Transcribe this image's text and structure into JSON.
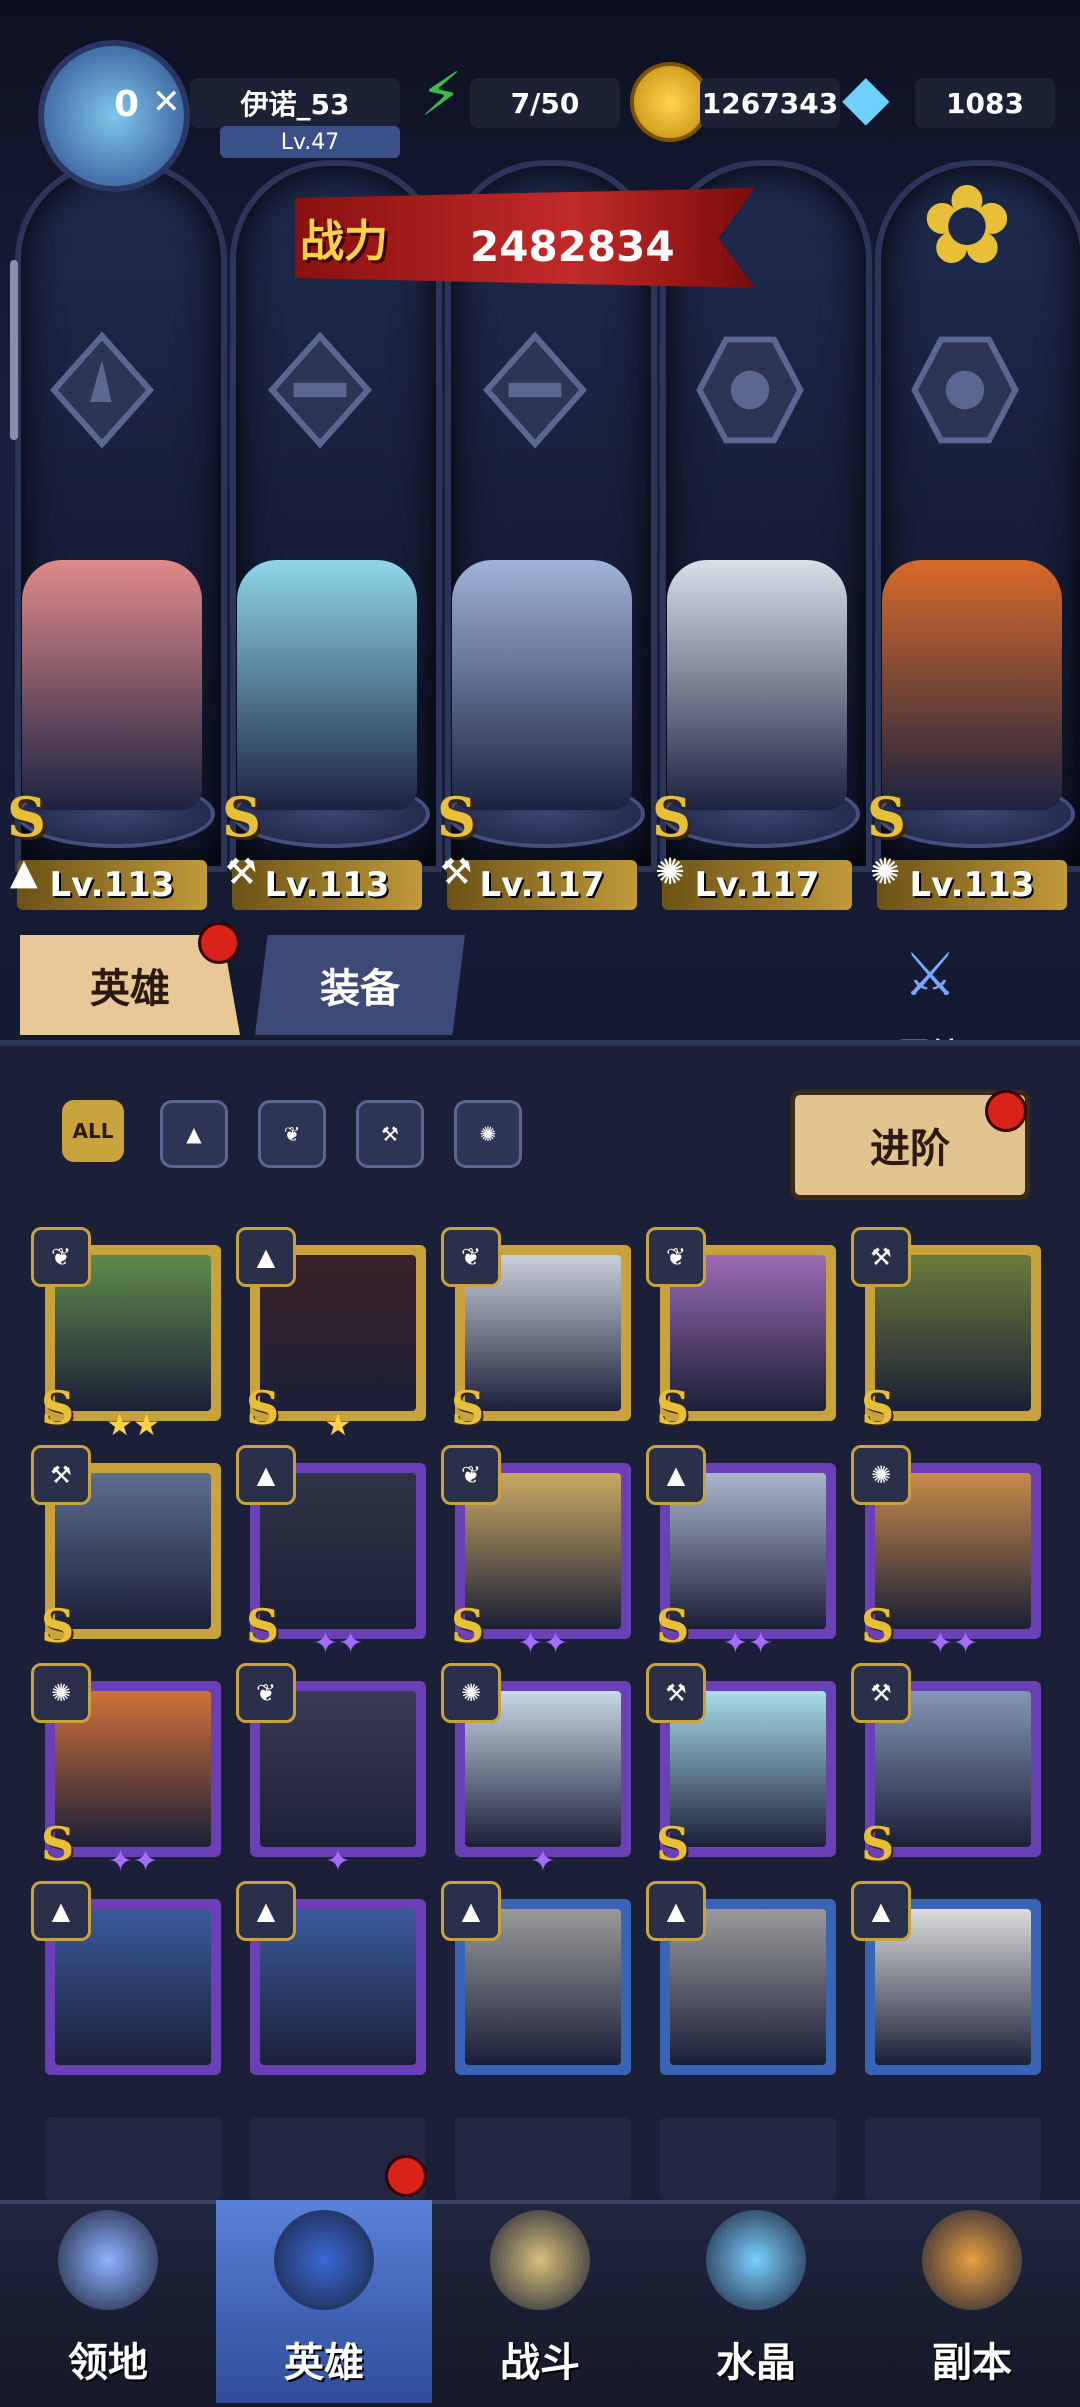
{
  "player": {
    "name": "伊诺_53",
    "level": "Lv.47",
    "avatar_badge": "0"
  },
  "resources": {
    "energy": "7/50",
    "gold": "1267343",
    "diamonds": "1083"
  },
  "power": {
    "label": "战力",
    "value": "2482834"
  },
  "team": [
    {
      "level": "Lv.113",
      "class_icon": "mage-icon",
      "rank": "S",
      "color": "#e08a8a"
    },
    {
      "level": "Lv.113",
      "class_icon": "wrench-icon",
      "rank": "S",
      "color": "#8fd6e8"
    },
    {
      "level": "Lv.117",
      "class_icon": "wrench-icon",
      "rank": "S",
      "color": "#9fb3d8"
    },
    {
      "level": "Lv.117",
      "class_icon": "beast-icon",
      "rank": "S",
      "color": "#d7dfe8"
    },
    {
      "level": "Lv.113",
      "class_icon": "beast-icon",
      "rank": "S",
      "color": "#d86a2a"
    }
  ],
  "tabs": {
    "heroes": "英雄",
    "equipment": "装备",
    "bonds": "羁绊"
  },
  "filters": {
    "all": "ALL"
  },
  "advance_button": "进阶",
  "roster": [
    {
      "class": "wing",
      "rank": "S",
      "stars": "★★",
      "frame": "gold",
      "color": "#5f8a4a"
    },
    {
      "class": "mage",
      "rank": "S",
      "stars": "★",
      "frame": "gold",
      "color": "#3a2026"
    },
    {
      "class": "wing",
      "rank": "S",
      "stars": "",
      "frame": "gold",
      "color": "#c9cfd8"
    },
    {
      "class": "wing",
      "rank": "S",
      "stars": "",
      "frame": "gold",
      "color": "#9a6ab5"
    },
    {
      "class": "wrench",
      "rank": "S",
      "stars": "",
      "frame": "gold",
      "color": "#6b7a3a"
    },
    {
      "class": "wrench",
      "rank": "S",
      "stars": "",
      "frame": "gold",
      "color": "#5b6e8c"
    },
    {
      "class": "mage",
      "rank": "S",
      "stars": "✦✦",
      "frame": "purple",
      "color": "#2f3346"
    },
    {
      "class": "wing",
      "rank": "S",
      "stars": "✦✦",
      "frame": "purple",
      "color": "#c9a862"
    },
    {
      "class": "mage",
      "rank": "S",
      "stars": "✦✦",
      "frame": "purple",
      "color": "#aab6cc"
    },
    {
      "class": "beast",
      "rank": "S",
      "stars": "✦✦",
      "frame": "purple",
      "color": "#c98a4a"
    },
    {
      "class": "beast",
      "rank": "S",
      "stars": "✦✦",
      "frame": "purple",
      "color": "#d0703a"
    },
    {
      "class": "wing",
      "rank": "",
      "stars": "✦",
      "frame": "purple",
      "color": "#3b3a55"
    },
    {
      "class": "beast",
      "rank": "",
      "stars": "✦",
      "frame": "purple",
      "color": "#c8d8e6"
    },
    {
      "class": "wrench",
      "rank": "S",
      "stars": "",
      "frame": "purple",
      "color": "#a8dde8"
    },
    {
      "class": "wrench",
      "rank": "S",
      "stars": "",
      "frame": "purple",
      "color": "#8497b5"
    },
    {
      "class": "mage",
      "rank": "",
      "stars": "",
      "frame": "purple",
      "color": "#3a5a9a"
    },
    {
      "class": "mage",
      "rank": "",
      "stars": "",
      "frame": "purple",
      "color": "#3a5a9a"
    },
    {
      "class": "mage",
      "rank": "",
      "stars": "",
      "frame": "blue",
      "color": "#9a9a9a"
    },
    {
      "class": "mage",
      "rank": "",
      "stars": "",
      "frame": "blue",
      "color": "#9a9a9a"
    },
    {
      "class": "mage",
      "rank": "",
      "stars": "",
      "frame": "blue",
      "color": "#dcdcdc"
    }
  ],
  "nav": [
    {
      "label": "领地",
      "icon": "castle-icon"
    },
    {
      "label": "英雄",
      "icon": "wizard-hat-icon"
    },
    {
      "label": "战斗",
      "icon": "sword-icon"
    },
    {
      "label": "水晶",
      "icon": "crystal-icon"
    },
    {
      "label": "副本",
      "icon": "portal-icon"
    }
  ]
}
